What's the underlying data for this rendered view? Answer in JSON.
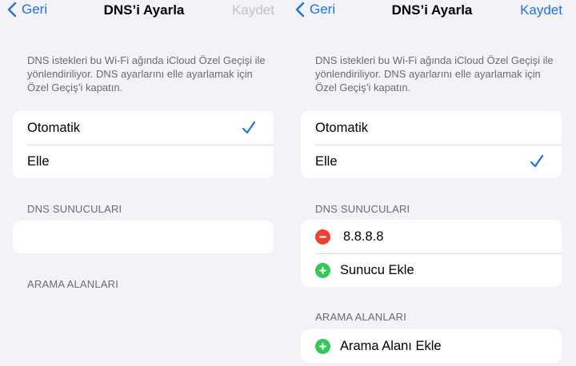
{
  "left": {
    "nav": {
      "back_label": "Geri",
      "title": "DNS’i Ayarla",
      "save_label": "Kaydet"
    },
    "info_text": "DNS istekleri bu Wi-Fi ağında iCloud Özel Geçişi ile yönlendiriliyor. DNS ayarlarını elle ayarlamak için Özel Geçiş’i kapatın.",
    "mode_options": [
      "Otomatik",
      "Elle"
    ],
    "selected_mode": "Otomatik",
    "dns_section_title": "DNS SUNUCULARI",
    "search_section_title": "ARAMA ALANLARI"
  },
  "right": {
    "nav": {
      "back_label": "Geri",
      "title": "DNS’i Ayarla",
      "save_label": "Kaydet"
    },
    "info_text": "DNS istekleri bu Wi-Fi ağında iCloud Özel Geçişi ile yönlendiriliyor. DNS ayarlarını elle ayarlamak için Özel Geçiş’i kapatın.",
    "mode_options": [
      "Otomatik",
      "Elle"
    ],
    "selected_mode": "Elle",
    "dns_section_title": "DNS SUNUCULARI",
    "dns_servers": [
      "8.8.8.8"
    ],
    "add_server_label": "Sunucu Ekle",
    "search_section_title": "ARAMA ALANLARI",
    "add_domain_label": "Arama Alanı Ekle"
  },
  "colors": {
    "accent": "#1a73e8",
    "remove": "#ea4335",
    "add": "#34c759",
    "disabled": "#c2c2c7"
  }
}
